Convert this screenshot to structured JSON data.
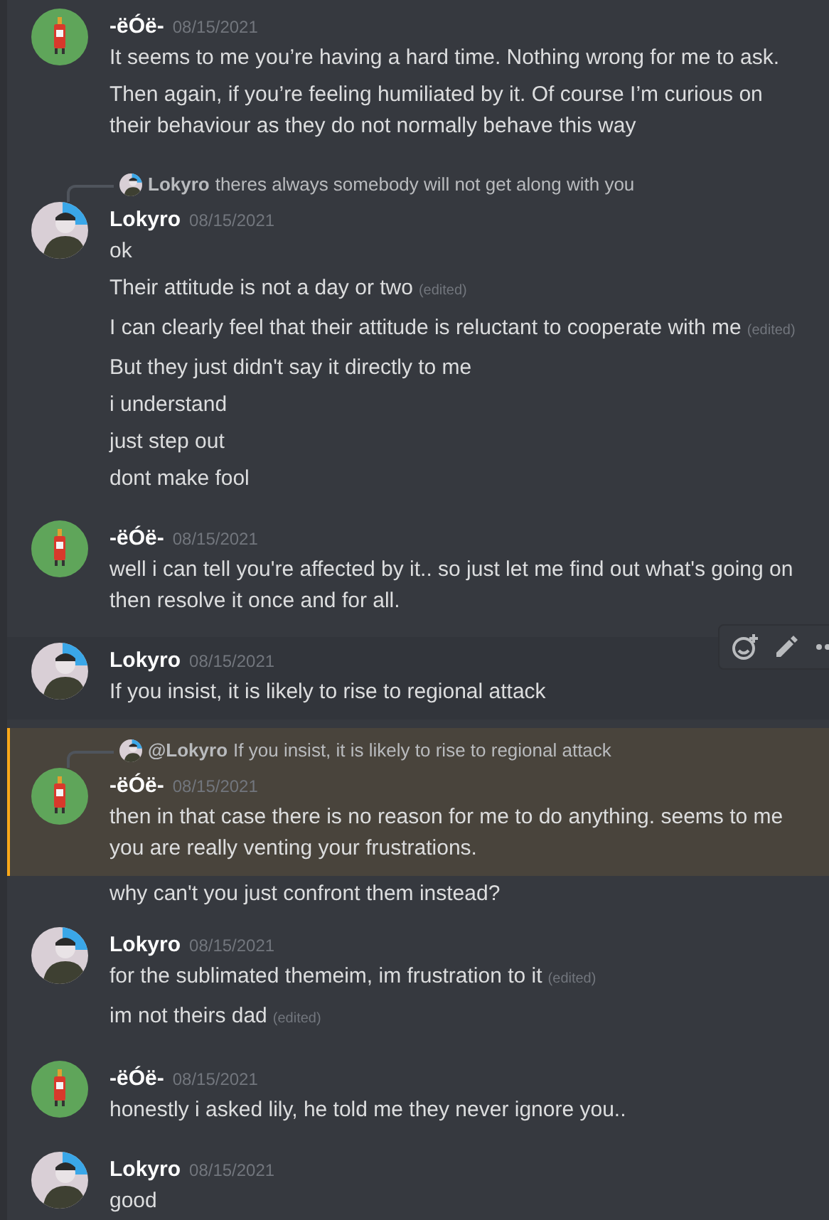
{
  "messages": [
    {
      "kind": "group",
      "author": "-ëÓë-",
      "avatar": {
        "kind": "bottle"
      },
      "timestamp": "08/15/2021",
      "highlighted": false,
      "hovered": false,
      "lines": [
        {
          "text": "It seems to me you’re having a hard time. Nothing wrong for me to ask."
        },
        {
          "text": "Then again, if you’re feeling humiliated by it. Of course I’m curious on their behaviour as they do not normally behave this way"
        }
      ]
    },
    {
      "kind": "group",
      "author": "Lokyro",
      "avatar": {
        "kind": "photo"
      },
      "timestamp": "08/15/2021",
      "highlighted": false,
      "hovered": false,
      "reply": {
        "avatar": {
          "kind": "photo"
        },
        "author": "Lokyro",
        "text": "theres always somebody will not get along with you"
      },
      "lines": [
        {
          "text": "ok"
        },
        {
          "text": "Their attitude is not a day or two",
          "edited": "(edited)"
        },
        {
          "text": "I can clearly feel that their attitude is reluctant to cooperate with me",
          "edited": "(edited)"
        },
        {
          "text": "But they just didn't say it directly to me"
        },
        {
          "text": "i understand"
        },
        {
          "text": "just step out"
        },
        {
          "text": "dont make fool"
        }
      ]
    },
    {
      "kind": "group",
      "author": "-ëÓë-",
      "avatar": {
        "kind": "bottle"
      },
      "timestamp": "08/15/2021",
      "highlighted": false,
      "hovered": false,
      "lines": [
        {
          "text": "well i can tell you're affected by it.. so just let me find out what's going on then resolve it once and for all."
        }
      ]
    },
    {
      "kind": "group",
      "author": "Lokyro",
      "avatar": {
        "kind": "photo"
      },
      "timestamp": "08/15/2021",
      "highlighted": false,
      "hovered": true,
      "lines": [
        {
          "text": "If you insist, it is likely to rise to regional attack"
        }
      ]
    },
    {
      "kind": "group",
      "author": "-ëÓë-",
      "avatar": {
        "kind": "bottle"
      },
      "timestamp": "08/15/2021",
      "highlighted": true,
      "hovered": false,
      "reply": {
        "avatar": {
          "kind": "photo"
        },
        "author": "@Lokyro",
        "text": "If you insist, it is likely to rise to regional attack"
      },
      "lines": [
        {
          "text": "then in that case there is no reason for me to do anything. seems to me you are really venting your frustrations."
        }
      ]
    },
    {
      "kind": "continuation",
      "lines": [
        {
          "text": "why can't you just confront them instead?"
        }
      ]
    },
    {
      "kind": "group",
      "author": "Lokyro",
      "avatar": {
        "kind": "photo"
      },
      "timestamp": "08/15/2021",
      "highlighted": false,
      "hovered": false,
      "lines": [
        {
          "text": "for the sublimated themeim, im frustration to it",
          "edited": "(edited)"
        },
        {
          "text": "im not theirs dad",
          "edited": "(edited)"
        }
      ]
    },
    {
      "kind": "group",
      "author": "-ëÓë-",
      "avatar": {
        "kind": "bottle"
      },
      "timestamp": "08/15/2021",
      "highlighted": false,
      "hovered": false,
      "lines": [
        {
          "text": "honestly i asked lily, he told me they never ignore you.."
        }
      ]
    },
    {
      "kind": "group",
      "author": "Lokyro",
      "avatar": {
        "kind": "photo"
      },
      "timestamp": "08/15/2021",
      "highlighted": false,
      "hovered": false,
      "lines": [
        {
          "text": "good"
        }
      ]
    }
  ]
}
